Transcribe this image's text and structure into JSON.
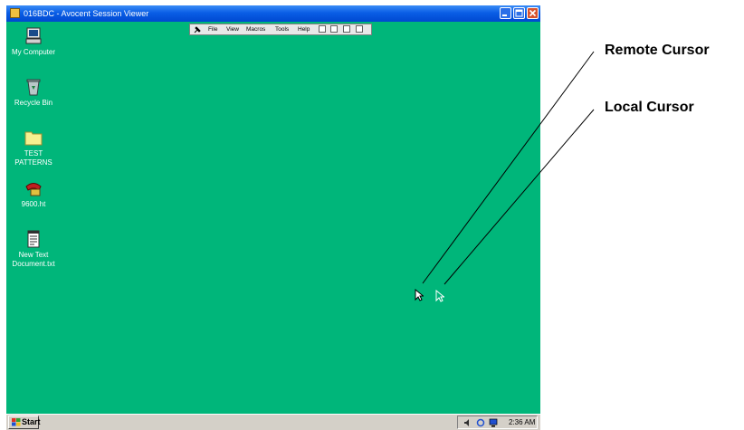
{
  "window": {
    "title": "016BDC - Avocent Session Viewer",
    "controls": [
      "minimize",
      "maximize",
      "close"
    ]
  },
  "menubar": {
    "items": [
      "File",
      "View",
      "Macros",
      "Tools",
      "Help"
    ]
  },
  "desktop": {
    "background_color": "#00b67a",
    "icons": [
      {
        "label_lines": [
          "My Computer"
        ],
        "icon": "computer-icon"
      },
      {
        "label_lines": [
          "Recycle Bin"
        ],
        "icon": "recycle-bin-icon"
      },
      {
        "label_lines": [
          "TEST",
          "PATTERNS"
        ],
        "icon": "folder-icon"
      },
      {
        "label_lines": [
          "9600.ht"
        ],
        "icon": "hyperterminal-icon"
      },
      {
        "label_lines": [
          "New Text",
          "Document.txt"
        ],
        "icon": "text-document-icon"
      }
    ]
  },
  "taskbar": {
    "start_label": "Start",
    "clock": "2:36 AM"
  },
  "callouts": {
    "remote_cursor": "Remote Cursor",
    "local_cursor": "Local Cursor"
  },
  "colors": {
    "titlebar": "#0a5ee6",
    "desktop": "#00b67a",
    "chrome": "#d4d0c8"
  }
}
